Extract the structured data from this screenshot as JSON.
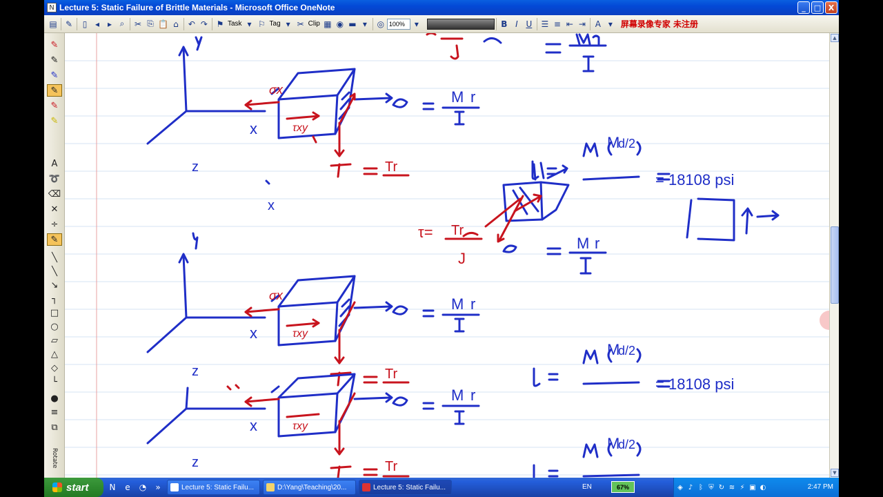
{
  "window": {
    "title": "Lecture 5: Static Failure of Brittle Materials - Microsoft Office OneNote",
    "minimize": "_",
    "maximize": "□",
    "close": "X"
  },
  "toolbar": {
    "task_label": "Task",
    "tag_label": "Tag",
    "clip_label": "Clip",
    "zoom_value": "100%",
    "overlay_text": "屏幕录像专家 未注册"
  },
  "taskbar": {
    "start_label": "start",
    "tasks": [
      {
        "label": "Lecture 5: Static Failu..."
      },
      {
        "label": "D:\\Yang\\Teaching\\20..."
      },
      {
        "label": "Lecture 5: Static Failu..."
      }
    ],
    "language": "EN",
    "battery": "67%",
    "clock": "2:47 PM"
  },
  "notes": {
    "sigma_x": "σx",
    "x_axis": "x",
    "y_axis": "y",
    "z_axis": "z",
    "tau_xy": "τxy",
    "M": "M",
    "r": "r",
    "I": "I",
    "J": "J",
    "Tr": "Tr",
    "d_over_2": "d/2",
    "psi_value": "= 18108 psi",
    "tau_eq": "τ=",
    "sigma_eq": "σ = ",
    "tau_xy_eq": "τxy ="
  },
  "colors": {
    "ink_blue": "#1f2ec7",
    "ink_red": "#c8141e",
    "rule_line": "#d6e3f3",
    "margin_line": "#eaa0a0"
  }
}
